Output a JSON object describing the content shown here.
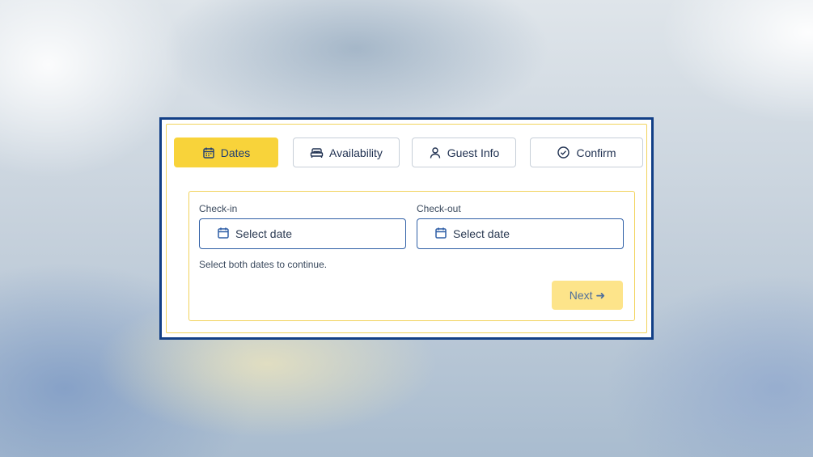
{
  "colors": {
    "frame_border": "#123f86",
    "accent_yellow": "#f8d33a",
    "next_disabled_bg": "#fde48a",
    "field_border": "#2f5fa6"
  },
  "steps": [
    {
      "label": "Dates",
      "icon": "calendar-icon",
      "active": true
    },
    {
      "label": "Availability",
      "icon": "bed-icon",
      "active": false
    },
    {
      "label": "Guest Info",
      "icon": "user-icon",
      "active": false
    },
    {
      "label": "Confirm",
      "icon": "check-circle-icon",
      "active": false
    }
  ],
  "form": {
    "checkin_label": "Check-in",
    "checkin_value": "Select date",
    "checkout_label": "Check-out",
    "checkout_value": "Select date",
    "hint": "Select both dates to continue.",
    "next_label": "Next",
    "next_arrow": "➜",
    "next_enabled": false
  }
}
